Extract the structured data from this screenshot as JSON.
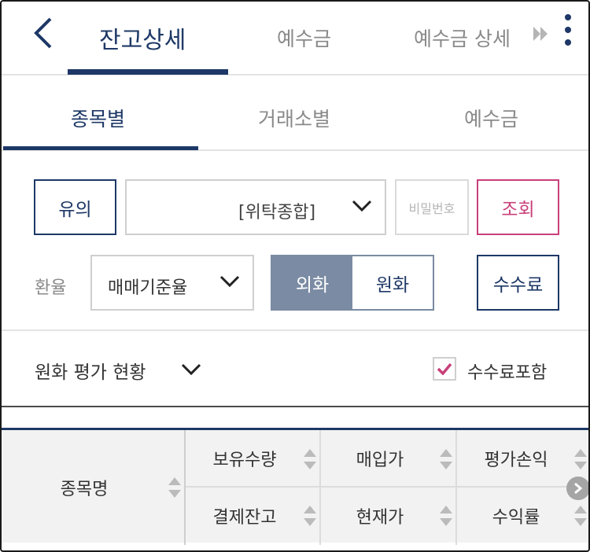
{
  "header": {
    "tabs": [
      {
        "label": "잔고상세",
        "active": true
      },
      {
        "label": "예수금",
        "active": false
      },
      {
        "label": "예수금 상세",
        "active": false
      }
    ]
  },
  "subtabs": [
    {
      "label": "종목별",
      "active": true
    },
    {
      "label": "거래소별",
      "active": false
    },
    {
      "label": "예수금",
      "active": false
    }
  ],
  "controls": {
    "notice_label": "유의",
    "account_value": "[위탁종합]",
    "password_placeholder": "비밀번호",
    "query_label": "조회",
    "rate_label": "환율",
    "rate_basis": "매매기준율",
    "currency_toggle": {
      "foreign": "외화",
      "won": "원화",
      "selected": "외화"
    },
    "fee_label": "수수료"
  },
  "summary": {
    "label": "원화 평가 현황",
    "include_fee_label": "수수료포함",
    "include_fee_checked": true
  },
  "table": {
    "first_col": "종목명",
    "row1": [
      "보유수량",
      "매입가",
      "평가손익"
    ],
    "row2": [
      "결제잔고",
      "현재가",
      "수익률"
    ]
  },
  "colors": {
    "navy": "#1d3866",
    "magenta": "#c8407a",
    "toggle_on": "#7a8ba3"
  }
}
